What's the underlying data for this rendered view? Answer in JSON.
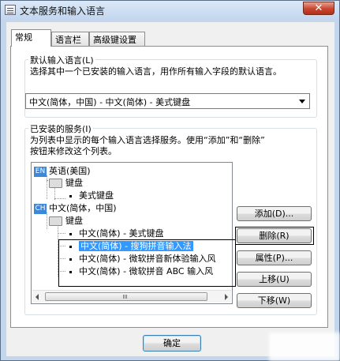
{
  "window": {
    "title": "文本服务和输入语言",
    "close_glyph": "✕"
  },
  "tabs": [
    {
      "label": "常规"
    },
    {
      "label": "语言栏"
    },
    {
      "label": "高级键设置"
    }
  ],
  "default_lang": {
    "group_label": "默认输入语言(L)",
    "description": "选择其中一个已安装的输入语言，用作所有输入字段的默认语言。",
    "selected": "中文(简体，中国) - 中文(简体) - 美式键盘"
  },
  "installed": {
    "group_label": "已安装的服务(I)",
    "description_line1": "为列表中显示的每个输入语言选择服务。使用“添加”和“删除”",
    "description_line2": "按钮来修改这个列表。",
    "tree": [
      {
        "badge": "EN",
        "label": "英语(美国)"
      },
      {
        "label": "键盘"
      },
      {
        "label": "美式键盘"
      },
      {
        "badge": "CH",
        "label": "中文(简体，中国)"
      },
      {
        "label": "键盘"
      },
      {
        "label": "中文(简体) - 美式键盘"
      },
      {
        "label": "中文(简体) - 搜狗拼音输入法"
      },
      {
        "label": "中文(简体) - 微软拼音新体验输入风"
      },
      {
        "label": "中文(简体) - 微软拼音 ABC 输入风"
      }
    ]
  },
  "buttons": {
    "add": "添加(D)...",
    "remove": "删除(R)",
    "properties": "属性(P)...",
    "move_up": "上移(U)",
    "move_down": "下移(W)",
    "ok": "确定"
  }
}
